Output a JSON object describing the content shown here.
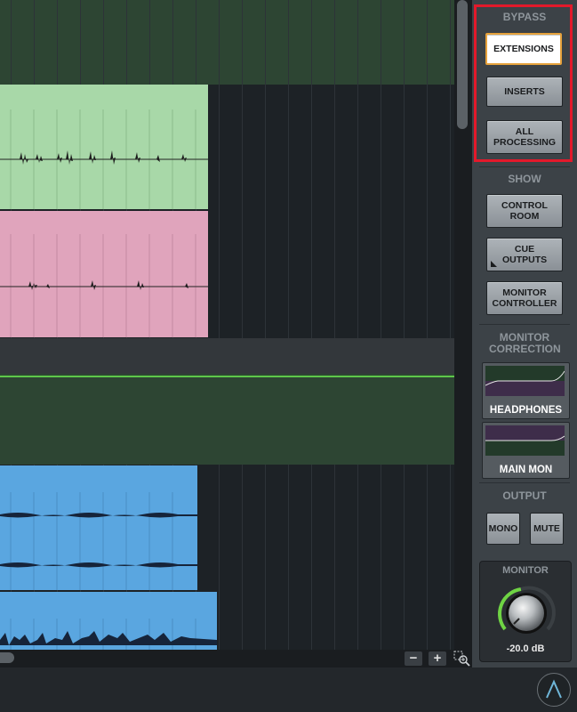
{
  "panel": {
    "bypass": {
      "label": "BYPASS",
      "extensions": "EXTENSIONS",
      "inserts": "INSERTS",
      "all_processing": "ALL PROCESSING"
    },
    "show": {
      "label": "SHOW",
      "control_room": "CONTROL ROOM",
      "cue_outputs": "CUE OUTPUTS",
      "monitor_controller": "MONITOR CONTROLLER"
    },
    "monitor_correction": {
      "label": "MONITOR CORRECTION",
      "headphones": "HEADPHONES",
      "main_mon": "MAIN MON"
    },
    "output": {
      "label": "OUTPUT",
      "mono": "MONO",
      "mute": "MUTE"
    },
    "monitor": {
      "label": "MONITOR",
      "level": "-20.0 dB"
    }
  },
  "zoom": {
    "minus": "−",
    "plus": "+"
  },
  "colors": {
    "highlight": "#e3192b",
    "green_region": "#a8d8a8",
    "pink_region": "#e0a4bc",
    "blue_region": "#5aa6e0",
    "knob_arc": "#6fd444"
  },
  "icons": [
    "zoom-to-fit-icon",
    "waves-logo-icon",
    "cue-corner-icon"
  ]
}
